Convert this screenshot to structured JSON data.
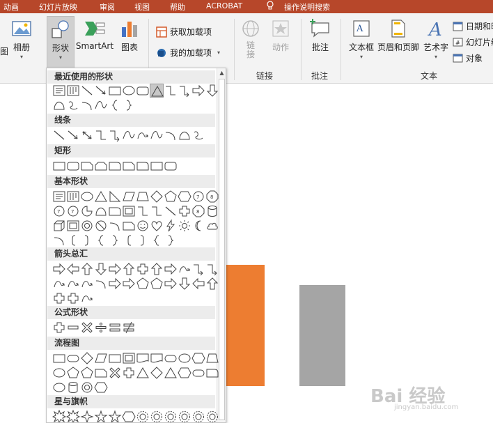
{
  "tabs": [
    "动画",
    "幻灯片放映",
    "审阅",
    "视图",
    "帮助",
    "ACROBAT",
    "操作说明搜索"
  ],
  "ribbon": {
    "left_partial": "图",
    "album": "相册",
    "shapes": "形状",
    "smartart": "SmartArt",
    "chart": "图表",
    "get_addins": "获取加载项",
    "my_addins": "我的加载项",
    "link": "链\n接",
    "action": "动作",
    "links_group": "链接",
    "comment": "批注",
    "comments_group": "批注",
    "textbox": "文本框",
    "header_footer": "页眉和页脚",
    "wordart": "艺术字",
    "date_time": "日期和时",
    "slide_number": "幻灯片编",
    "object": "对象",
    "text_group": "文本"
  },
  "shapes_menu": {
    "categories": [
      "最近使用的形状",
      "线条",
      "矩形",
      "基本形状",
      "箭头总汇",
      "公式形状",
      "流程图",
      "星与旗帜"
    ]
  },
  "colors": {
    "accent": "#b7472a",
    "bar_orange": "#ed7d31",
    "bar_gray": "#a5a5a5"
  },
  "watermark": {
    "brand": "Bai 经验",
    "url": "jingyan.baidu.com"
  }
}
